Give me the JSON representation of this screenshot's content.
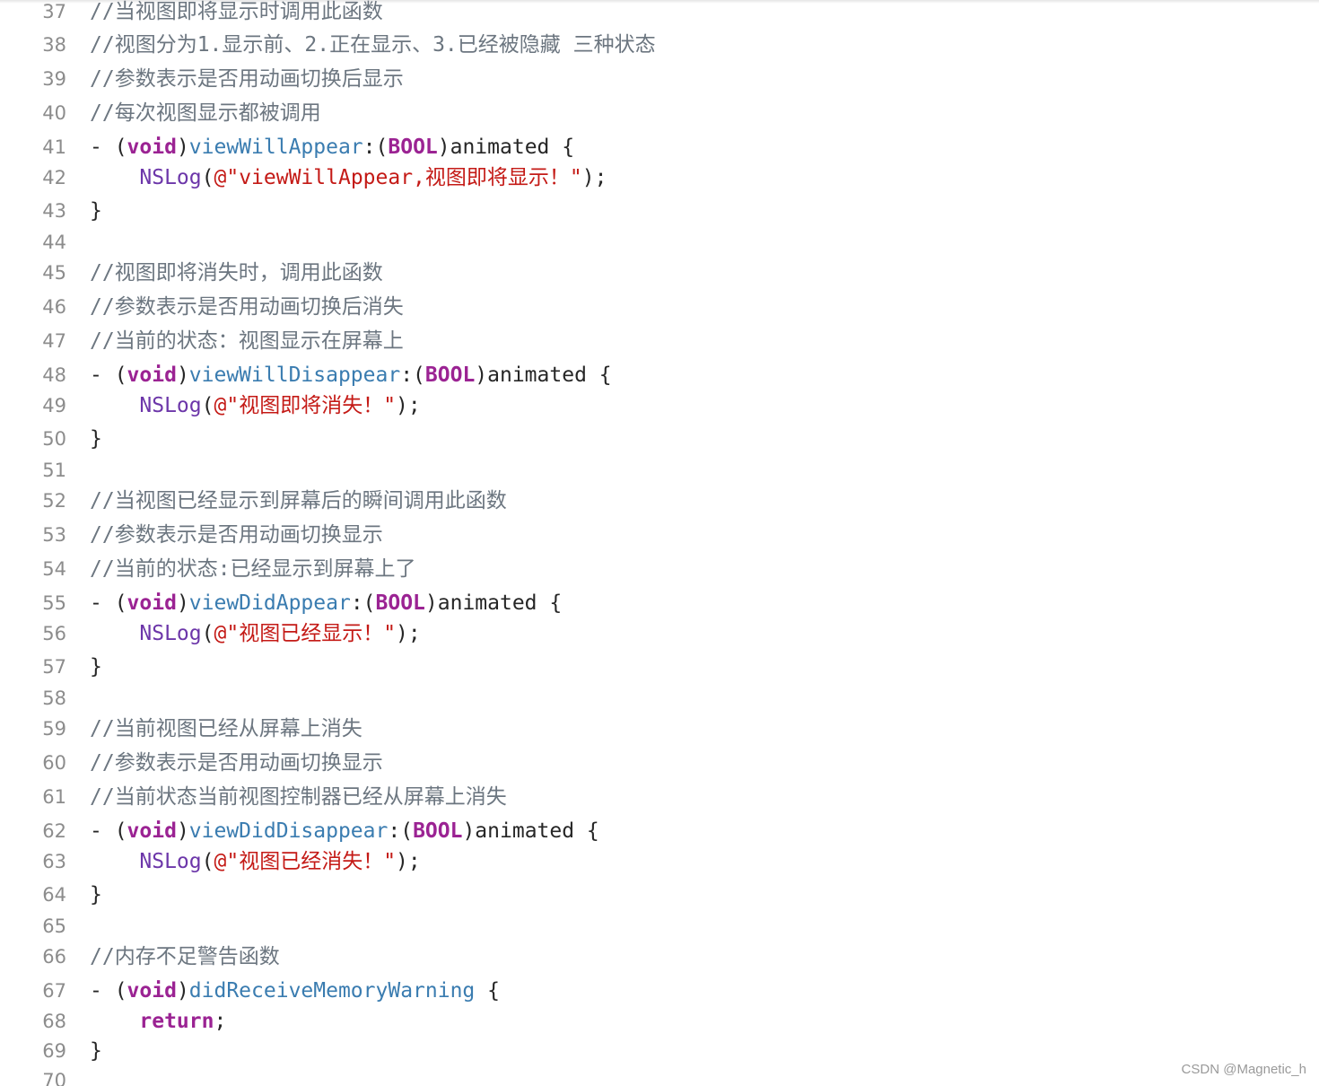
{
  "editor": {
    "lines": [
      {
        "num": "37",
        "tokens": [
          {
            "t": "cmt",
            "v": "//当视图即将显示时调用此函数"
          }
        ]
      },
      {
        "num": "38",
        "tokens": [
          {
            "t": "cmt",
            "v": "//视图分为1.显示前、2.正在显示、3.已经被隐藏 三种状态"
          }
        ]
      },
      {
        "num": "39",
        "tokens": [
          {
            "t": "cmt",
            "v": "//参数表示是否用动画切换后显示"
          }
        ]
      },
      {
        "num": "40",
        "tokens": [
          {
            "t": "cmt",
            "v": "//每次视图显示都被调用"
          }
        ]
      },
      {
        "num": "41",
        "tokens": [
          {
            "t": "plain",
            "v": "- ("
          },
          {
            "t": "kw",
            "v": "void"
          },
          {
            "t": "plain",
            "v": ")"
          },
          {
            "t": "fn",
            "v": "viewWillAppear"
          },
          {
            "t": "plain",
            "v": ":("
          },
          {
            "t": "kw",
            "v": "BOOL"
          },
          {
            "t": "plain",
            "v": ")animated {"
          }
        ]
      },
      {
        "num": "42",
        "tokens": [
          {
            "t": "plain",
            "v": "    "
          },
          {
            "t": "nslog",
            "v": "NSLog"
          },
          {
            "t": "plain",
            "v": "("
          },
          {
            "t": "str",
            "v": "@\"viewWillAppear,视图即将显示！\""
          },
          {
            "t": "plain",
            "v": ");"
          }
        ]
      },
      {
        "num": "43",
        "tokens": [
          {
            "t": "plain",
            "v": "}"
          }
        ]
      },
      {
        "num": "44",
        "tokens": []
      },
      {
        "num": "45",
        "tokens": [
          {
            "t": "cmt",
            "v": "//视图即将消失时，调用此函数"
          }
        ]
      },
      {
        "num": "46",
        "tokens": [
          {
            "t": "cmt",
            "v": "//参数表示是否用动画切换后消失"
          }
        ]
      },
      {
        "num": "47",
        "tokens": [
          {
            "t": "cmt",
            "v": "//当前的状态：视图显示在屏幕上"
          }
        ]
      },
      {
        "num": "48",
        "tokens": [
          {
            "t": "plain",
            "v": "- ("
          },
          {
            "t": "kw",
            "v": "void"
          },
          {
            "t": "plain",
            "v": ")"
          },
          {
            "t": "fn",
            "v": "viewWillDisappear"
          },
          {
            "t": "plain",
            "v": ":("
          },
          {
            "t": "kw",
            "v": "BOOL"
          },
          {
            "t": "plain",
            "v": ")animated {"
          }
        ]
      },
      {
        "num": "49",
        "tokens": [
          {
            "t": "plain",
            "v": "    "
          },
          {
            "t": "nslog",
            "v": "NSLog"
          },
          {
            "t": "plain",
            "v": "("
          },
          {
            "t": "str",
            "v": "@\"视图即将消失！\""
          },
          {
            "t": "plain",
            "v": ");"
          }
        ]
      },
      {
        "num": "50",
        "tokens": [
          {
            "t": "plain",
            "v": "}"
          }
        ]
      },
      {
        "num": "51",
        "tokens": []
      },
      {
        "num": "52",
        "tokens": [
          {
            "t": "cmt",
            "v": "//当视图已经显示到屏幕后的瞬间调用此函数"
          }
        ]
      },
      {
        "num": "53",
        "tokens": [
          {
            "t": "cmt",
            "v": "//参数表示是否用动画切换显示"
          }
        ]
      },
      {
        "num": "54",
        "tokens": [
          {
            "t": "cmt",
            "v": "//当前的状态:已经显示到屏幕上了"
          }
        ]
      },
      {
        "num": "55",
        "tokens": [
          {
            "t": "plain",
            "v": "- ("
          },
          {
            "t": "kw",
            "v": "void"
          },
          {
            "t": "plain",
            "v": ")"
          },
          {
            "t": "fn",
            "v": "viewDidAppear"
          },
          {
            "t": "plain",
            "v": ":("
          },
          {
            "t": "kw",
            "v": "BOOL"
          },
          {
            "t": "plain",
            "v": ")animated {"
          }
        ]
      },
      {
        "num": "56",
        "tokens": [
          {
            "t": "plain",
            "v": "    "
          },
          {
            "t": "nslog",
            "v": "NSLog"
          },
          {
            "t": "plain",
            "v": "("
          },
          {
            "t": "str",
            "v": "@\"视图已经显示！\""
          },
          {
            "t": "plain",
            "v": ");"
          }
        ]
      },
      {
        "num": "57",
        "tokens": [
          {
            "t": "plain",
            "v": "}"
          }
        ]
      },
      {
        "num": "58",
        "tokens": []
      },
      {
        "num": "59",
        "tokens": [
          {
            "t": "cmt",
            "v": "//当前视图已经从屏幕上消失"
          }
        ]
      },
      {
        "num": "60",
        "tokens": [
          {
            "t": "cmt",
            "v": "//参数表示是否用动画切换显示"
          }
        ]
      },
      {
        "num": "61",
        "tokens": [
          {
            "t": "cmt",
            "v": "//当前状态当前视图控制器已经从屏幕上消失"
          }
        ]
      },
      {
        "num": "62",
        "tokens": [
          {
            "t": "plain",
            "v": "- ("
          },
          {
            "t": "kw",
            "v": "void"
          },
          {
            "t": "plain",
            "v": ")"
          },
          {
            "t": "fn",
            "v": "viewDidDisappear"
          },
          {
            "t": "plain",
            "v": ":("
          },
          {
            "t": "kw",
            "v": "BOOL"
          },
          {
            "t": "plain",
            "v": ")animated {"
          }
        ]
      },
      {
        "num": "63",
        "tokens": [
          {
            "t": "plain",
            "v": "    "
          },
          {
            "t": "nslog",
            "v": "NSLog"
          },
          {
            "t": "plain",
            "v": "("
          },
          {
            "t": "str",
            "v": "@\"视图已经消失！\""
          },
          {
            "t": "plain",
            "v": ");"
          }
        ]
      },
      {
        "num": "64",
        "tokens": [
          {
            "t": "plain",
            "v": "}"
          }
        ]
      },
      {
        "num": "65",
        "tokens": []
      },
      {
        "num": "66",
        "tokens": [
          {
            "t": "cmt",
            "v": "//内存不足警告函数"
          }
        ]
      },
      {
        "num": "67",
        "tokens": [
          {
            "t": "plain",
            "v": "- ("
          },
          {
            "t": "kw",
            "v": "void"
          },
          {
            "t": "plain",
            "v": ")"
          },
          {
            "t": "fn",
            "v": "didReceiveMemoryWarning"
          },
          {
            "t": "plain",
            "v": " {"
          }
        ]
      },
      {
        "num": "68",
        "tokens": [
          {
            "t": "plain",
            "v": "    "
          },
          {
            "t": "kw",
            "v": "return"
          },
          {
            "t": "plain",
            "v": ";"
          }
        ]
      },
      {
        "num": "69",
        "tokens": [
          {
            "t": "plain",
            "v": "}"
          }
        ]
      },
      {
        "num": "70",
        "tokens": []
      }
    ]
  },
  "watermark": {
    "text": "CSDN @Magnetic_h"
  }
}
